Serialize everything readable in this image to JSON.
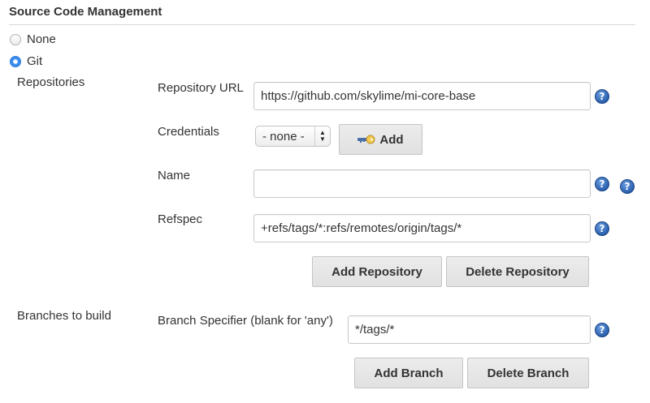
{
  "section": {
    "title": "Source Code Management"
  },
  "scm": {
    "options": [
      {
        "label": "None",
        "selected": false
      },
      {
        "label": "Git",
        "selected": true
      }
    ]
  },
  "repositories": {
    "label": "Repositories",
    "url_label": "Repository URL",
    "url_value": "https://github.com/skylime/mi-core-base",
    "credentials_label": "Credentials",
    "credentials_value": "- none -",
    "add_label": "Add",
    "name_label": "Name",
    "name_value": "",
    "refspec_label": "Refspec",
    "refspec_value": "+refs/tags/*:refs/remotes/origin/tags/*",
    "add_repo_label": "Add Repository",
    "delete_repo_label": "Delete Repository"
  },
  "branches": {
    "label": "Branches to build",
    "specifier_label": "Branch Specifier (blank for 'any')",
    "specifier_value": "*/tags/*",
    "add_branch_label": "Add Branch",
    "delete_branch_label": "Delete Branch"
  },
  "help_glyph": "?",
  "colors": {
    "accent": "#3b8ef0",
    "help": "#2a5fae"
  }
}
